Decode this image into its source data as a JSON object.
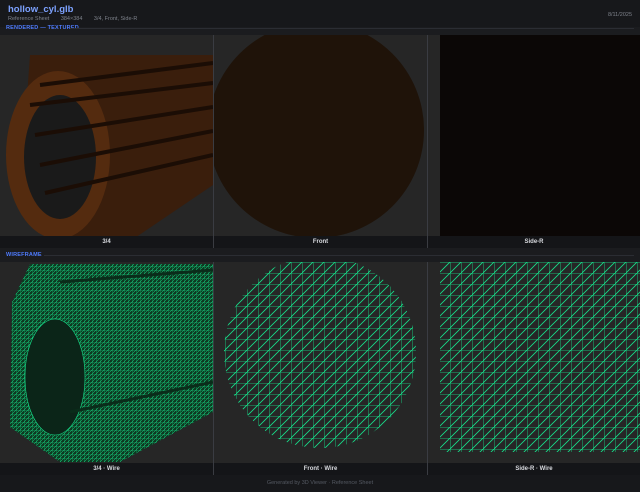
{
  "header": {
    "title": "hollow_cyl.glb",
    "subtitle_kind": "Reference Sheet",
    "subtitle_size": "384×384",
    "subtitle_views": "3/4, Front, Side-R",
    "date": "8/11/2025"
  },
  "sections": {
    "rendered_label": "RENDERED — TEXTURED",
    "wire_label": "WIREFRAME"
  },
  "rendered_panels": [
    {
      "caption": "3/4"
    },
    {
      "caption": "Front"
    },
    {
      "caption": "Side-R"
    }
  ],
  "wire_panels": [
    {
      "caption": "3/4 · Wire"
    },
    {
      "caption": "Front · Wire"
    },
    {
      "caption": "Side-R · Wire"
    }
  ],
  "footer": {
    "text": "Generated by 3D Viewer · Reference Sheet"
  },
  "colors": {
    "accent": "#4f7cff",
    "title": "#7da2ff",
    "wire": "#16e08a",
    "texture": "#3a1f0c"
  }
}
